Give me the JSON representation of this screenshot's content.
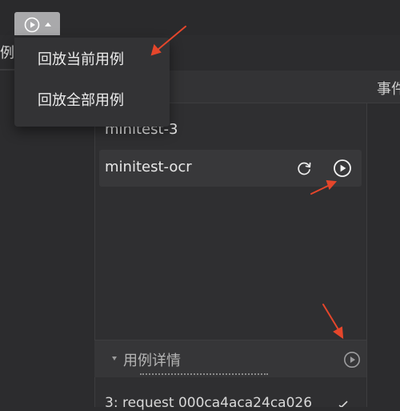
{
  "left_panel": {
    "label_fragment": "例"
  },
  "dropdown": {
    "items": [
      {
        "label": "回放当前用例"
      },
      {
        "label": "回放全部用例"
      }
    ]
  },
  "case_list": {
    "items": [
      {
        "name": "minitest-3"
      },
      {
        "name": "minitest-ocr",
        "active": true
      }
    ]
  },
  "right_panel": {
    "title_fragment": "事件"
  },
  "details": {
    "title": "用例详情",
    "first_line": "3: request 000ca4aca24ca026"
  },
  "colors": {
    "annotation_arrow": "#e5462b",
    "selected_button": "#a9a9ab"
  },
  "icons": {
    "replay": "refresh-icon",
    "play": "play-circle-icon",
    "dropdown": "caret-up-icon"
  }
}
